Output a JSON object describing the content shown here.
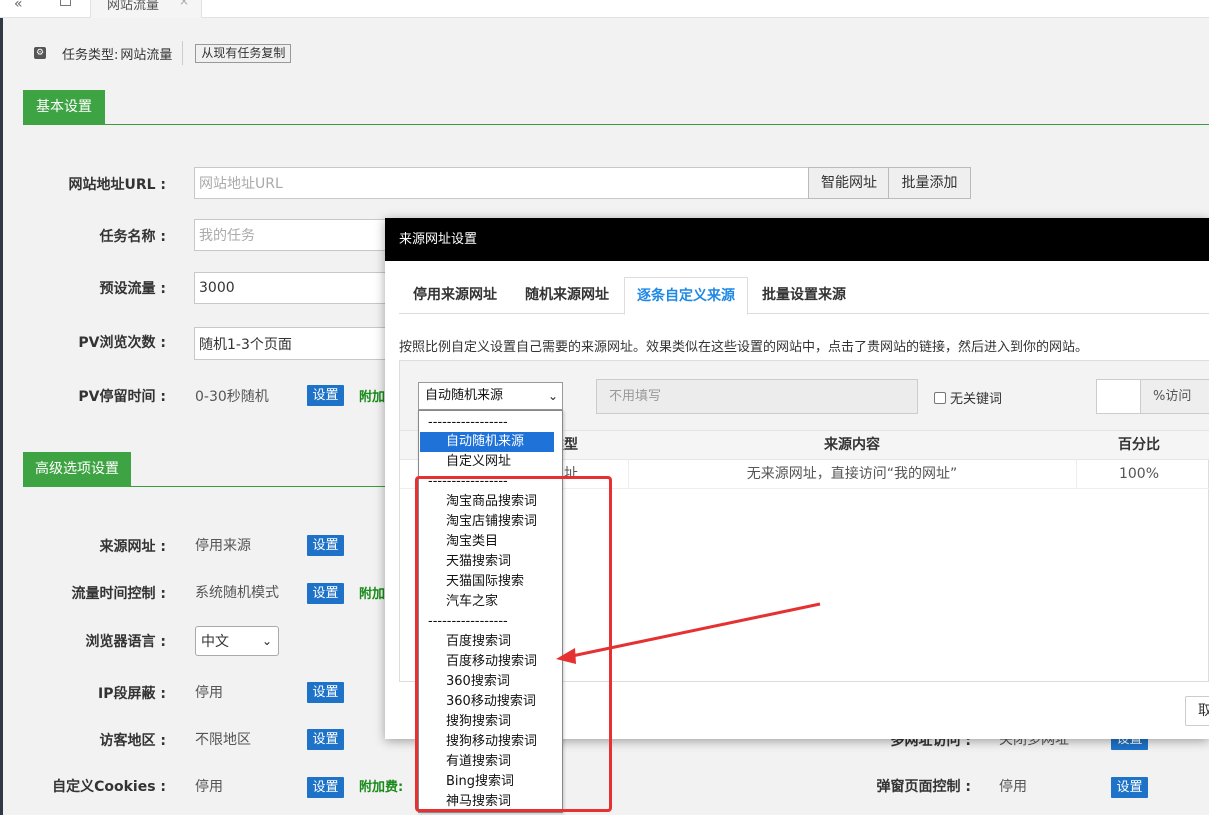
{
  "topbar": {
    "nav_back": "«",
    "tab_title": "网站流量",
    "tab_close": "×"
  },
  "task": {
    "type_label": "任务类型:",
    "type_value": "网站流量",
    "copy_button": "从现有任务复制"
  },
  "sections": {
    "basic": "基本设置",
    "advanced": "高级选项设置"
  },
  "form": {
    "url_label": "网站地址URL :",
    "url_placeholder": "网站地址URL",
    "smart_url_button": "智能网址",
    "batch_add_button": "批量添加",
    "task_name_label": "任务名称 :",
    "task_name_placeholder": "我的任务",
    "preset_traffic_label": "预设流量 :",
    "preset_traffic_value": "3000",
    "pv_count_label": "PV浏览次数 :",
    "pv_count_value": "随机1-3个页面",
    "pv_stay_label": "PV停留时间 :",
    "pv_stay_value": "0-30秒随机",
    "set_button": "设置",
    "fee_label_short": "附加",
    "fee_label": "附加费:",
    "source_url_label": "来源网址 :",
    "source_url_value": "停用来源",
    "traffic_time_label": "流量时间控制 :",
    "traffic_time_value": "系统随机模式",
    "browser_lang_label": "浏览器语言 :",
    "browser_lang_value": "中文",
    "ip_block_label": "IP段屏蔽 :",
    "ip_block_value": "停用",
    "visitor_region_label": "访客地区 :",
    "visitor_region_value": "不限地区",
    "cookies_label": "自定义Cookies :",
    "cookies_value": "停用",
    "multi_url_label": "多网址访问 :",
    "multi_url_value": "关闭多网址",
    "popup_label": "弹窗页面控制 :",
    "popup_value": "停用"
  },
  "modal": {
    "title": "来源网址设置",
    "tabs": [
      {
        "label": "停用来源网址"
      },
      {
        "label": "随机来源网址"
      },
      {
        "label": "逐条自定义来源"
      },
      {
        "label": "批量设置来源"
      }
    ],
    "description": "按照比例自定义设置自己需要的来源网址。效果类似在这些设置的网站中，点击了贵网站的链接，然后进入到你的网站。",
    "source_select_value": "自动随机来源",
    "no_fill_placeholder": "不用填写",
    "no_keyword_label": "无关键词",
    "percent_label": "%访问",
    "table": {
      "headers": [
        "类型",
        "来源内容",
        "百分比"
      ],
      "rows": [
        {
          "type": "网址",
          "content": "无来源网址，直接访问“我的网址”",
          "percent": "100%"
        }
      ]
    },
    "cancel_partial": "取"
  },
  "dropdown": {
    "items": [
      {
        "label": "-----------------",
        "kind": "separator"
      },
      {
        "label": "自动随机来源",
        "kind": "selected"
      },
      {
        "label": "自定义网址",
        "kind": "option"
      },
      {
        "label": "-----------------",
        "kind": "separator"
      },
      {
        "label": "淘宝商品搜索词",
        "kind": "option"
      },
      {
        "label": "淘宝店铺搜索词",
        "kind": "option"
      },
      {
        "label": "淘宝类目",
        "kind": "option"
      },
      {
        "label": "天猫搜索词",
        "kind": "option"
      },
      {
        "label": "天猫国际搜索",
        "kind": "option"
      },
      {
        "label": "汽车之家",
        "kind": "option"
      },
      {
        "label": "-----------------",
        "kind": "separator"
      },
      {
        "label": "百度搜索词",
        "kind": "option"
      },
      {
        "label": "百度移动搜索词",
        "kind": "option"
      },
      {
        "label": "360搜索词",
        "kind": "option"
      },
      {
        "label": "360移动搜索词",
        "kind": "option"
      },
      {
        "label": "搜狗搜索词",
        "kind": "option"
      },
      {
        "label": "搜狗移动搜索词",
        "kind": "option"
      },
      {
        "label": "有道搜索词",
        "kind": "option"
      },
      {
        "label": "Bing搜索词",
        "kind": "option"
      },
      {
        "label": "神马搜索词",
        "kind": "option"
      }
    ]
  },
  "colors": {
    "accent_green": "#3ea443",
    "button_blue": "#1e73c8",
    "tab_active": "#1e88e5",
    "annotation_red": "#e53131"
  }
}
